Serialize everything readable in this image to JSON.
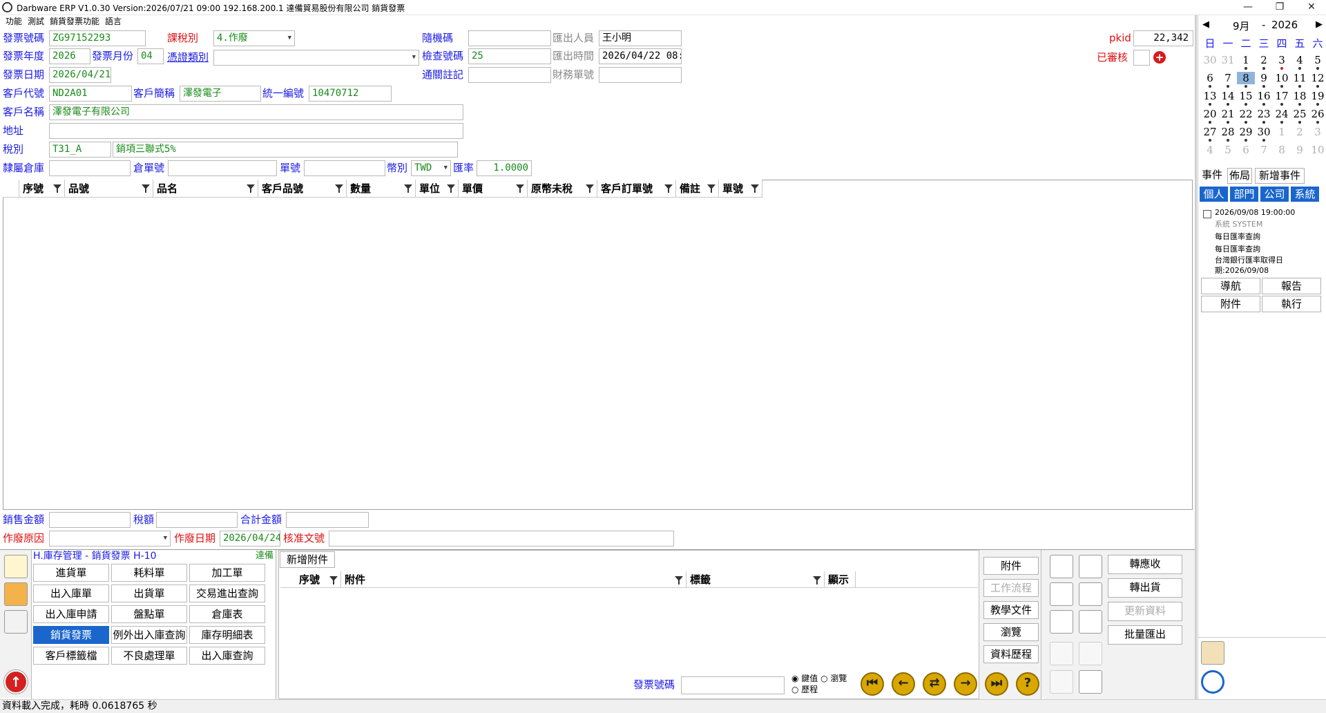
{
  "window": {
    "title": "Darbware ERP V1.0.30 Version:2026/07/21 09:00    192.168.200.1  達備貿易股份有限公司  銷貨發票"
  },
  "menu": [
    "功能",
    "測試",
    "銷貨發票功能",
    "語言"
  ],
  "form": {
    "inv_no_label": "發票號碼",
    "inv_no": "ZG97152293",
    "tax_type_label": "課稅別",
    "tax_type": "4.作廢",
    "random_label": "隨機碼",
    "random": "",
    "exporter_label": "匯出人員",
    "exporter": "王小明",
    "pkid_label": "pkid",
    "pkid": "22,342",
    "year_label": "發票年度",
    "year": "2026",
    "month_label": "發票月份",
    "month": "04",
    "cert_label": "憑證類別",
    "cert": "",
    "check_label": "檢查號碼",
    "check": "25",
    "export_time_label": "匯出時間",
    "export_time": "2026/04/22 08:",
    "audited_label": "已審核",
    "date_label": "發票日期",
    "date": "2026/04/21",
    "customs_label": "通關註記",
    "customs": "",
    "finance_label": "財務單號",
    "finance": "",
    "cust_code_label": "客戶代號",
    "cust_code": "ND2A01",
    "cust_short_label": "客戶簡稱",
    "cust_short": "澤發電子",
    "unified_label": "統一編號",
    "unified": "10470712",
    "cust_name_label": "客戶名稱",
    "cust_name": "澤發電子有限公司",
    "address_label": "地址",
    "address": "",
    "tax_label": "稅別",
    "tax_code": "T31_A",
    "tax_desc": "銷項三聯式5%",
    "warehouse_label": "隸屬倉庫",
    "warehouse": "",
    "wh_no_label": "倉單號",
    "wh_no": "",
    "doc_no_label": "單號",
    "doc_no": "",
    "currency_label": "幣別",
    "currency": "TWD",
    "rate_label": "匯率",
    "rate": "1.0000"
  },
  "grid": {
    "columns": [
      "序號",
      "品號",
      "品名",
      "客戶品號",
      "數量",
      "單位",
      "單價",
      "原幣未稅",
      "客戶訂單號",
      "備註",
      "單號"
    ]
  },
  "totals": {
    "sales_label": "銷售金額",
    "sales": "",
    "taxamt_label": "稅額",
    "taxamt": "",
    "total_label": "合計金額",
    "total": "",
    "void_reason_label": "作廢原因",
    "void_reason": "",
    "void_date_label": "作廢日期",
    "void_date": "2026/04/24",
    "approval_label": "核准文號",
    "approval": ""
  },
  "modules": {
    "header": "H.庫存管理 - 銷貨發票  H-10",
    "company": "達備",
    "items": [
      "進貨單",
      "耗料單",
      "加工單",
      "出入庫單",
      "出貨單",
      "交易進出查詢",
      "出入庫申請",
      "盤點單",
      "倉庫表",
      "銷貨發票",
      "例外出入庫查詢",
      "庫存明細表",
      "客戶標籤檔",
      "不良處理單",
      "出入庫查詢"
    ]
  },
  "attach": {
    "add_tab": "新增附件",
    "columns": [
      "序號",
      "附件",
      "標籤",
      "顯示"
    ],
    "side_buttons": [
      "附件",
      "工作流程",
      "教學文件",
      "瀏覽",
      "資料歷程"
    ],
    "search_label": "發票號碼",
    "search_value": "",
    "radio": [
      "鍵值",
      "瀏覽",
      "歷程"
    ]
  },
  "actions": [
    "轉應收",
    "轉出貨",
    "更新資料",
    "批量匯出"
  ],
  "calendar": {
    "month": "9月",
    "year": "2026",
    "weekdays": [
      "日",
      "一",
      "二",
      "三",
      "四",
      "五",
      "六"
    ],
    "days": [
      "30",
      "31",
      "1",
      "2",
      "3",
      "4",
      "5",
      "6",
      "7",
      "8",
      "9",
      "10",
      "11",
      "12",
      "13",
      "14",
      "15",
      "16",
      "17",
      "18",
      "19",
      "20",
      "21",
      "22",
      "23",
      "24",
      "25",
      "26",
      "27",
      "28",
      "29",
      "30",
      "1",
      "2",
      "3",
      "4",
      "5",
      "6",
      "7",
      "8",
      "9",
      "10"
    ]
  },
  "events": {
    "tabs": [
      "事件",
      "佈局",
      "新增事件"
    ],
    "scope": [
      "個人",
      "部門",
      "公司",
      "系統"
    ],
    "item": {
      "time": "2026/09/08 19:00:00",
      "source": "系統  SYSTEM",
      "title": "每日匯率查詢",
      "desc": "每日匯率查詢",
      "detail1": "台灣銀行匯率取得日",
      "detail2": "期:2026/09/08"
    },
    "buttons": [
      "導航",
      "報告",
      "附件",
      "執行"
    ]
  },
  "status": "資料載入完成，耗時 0.0618765 秒"
}
